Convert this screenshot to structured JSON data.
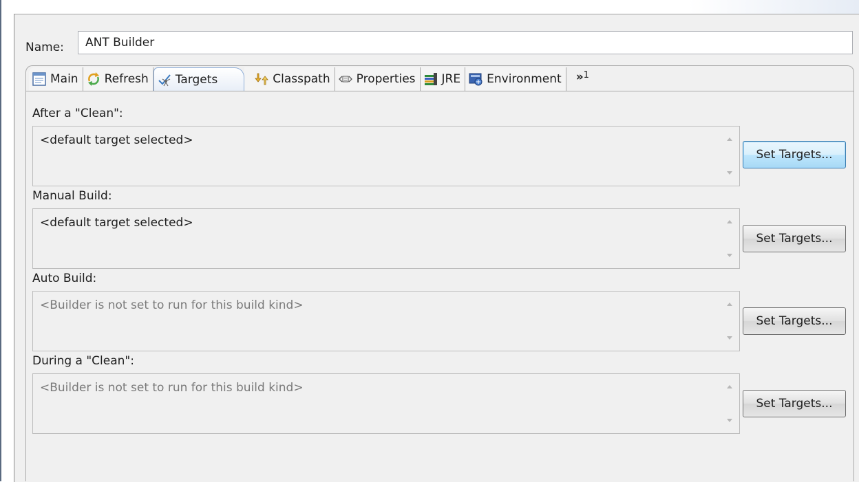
{
  "name_field": {
    "label": "Name:",
    "value": "ANT Builder"
  },
  "tabs": [
    {
      "label": "Main",
      "icon": "main-page-icon"
    },
    {
      "label": "Refresh",
      "icon": "refresh-icon"
    },
    {
      "label": "Targets",
      "icon": "targets-icon",
      "active": true
    },
    {
      "label": "Classpath",
      "icon": "classpath-icon"
    },
    {
      "label": "Properties",
      "icon": "properties-icon"
    },
    {
      "label": "JRE",
      "icon": "jre-icon"
    },
    {
      "label": "Environment",
      "icon": "environment-icon"
    }
  ],
  "overflow": {
    "chevron": "»",
    "count": "1"
  },
  "sections": [
    {
      "label": "After a \"Clean\":",
      "value": "<default target selected>",
      "enabled": true,
      "button": "Set Targets..."
    },
    {
      "label": "Manual Build:",
      "value": "<default target selected>",
      "enabled": true,
      "button": "Set Targets..."
    },
    {
      "label": "Auto Build:",
      "value": "<Builder is not set to run for this build kind>",
      "enabled": false,
      "button": "Set Targets..."
    },
    {
      "label": "During a \"Clean\":",
      "value": "<Builder is not set to run for this build kind>",
      "enabled": false,
      "button": "Set Targets..."
    }
  ],
  "colors": {
    "active_tab_border": "#8faed8",
    "focused_button": "#3c7fb1",
    "disabled_text": "#7a7a7a"
  }
}
